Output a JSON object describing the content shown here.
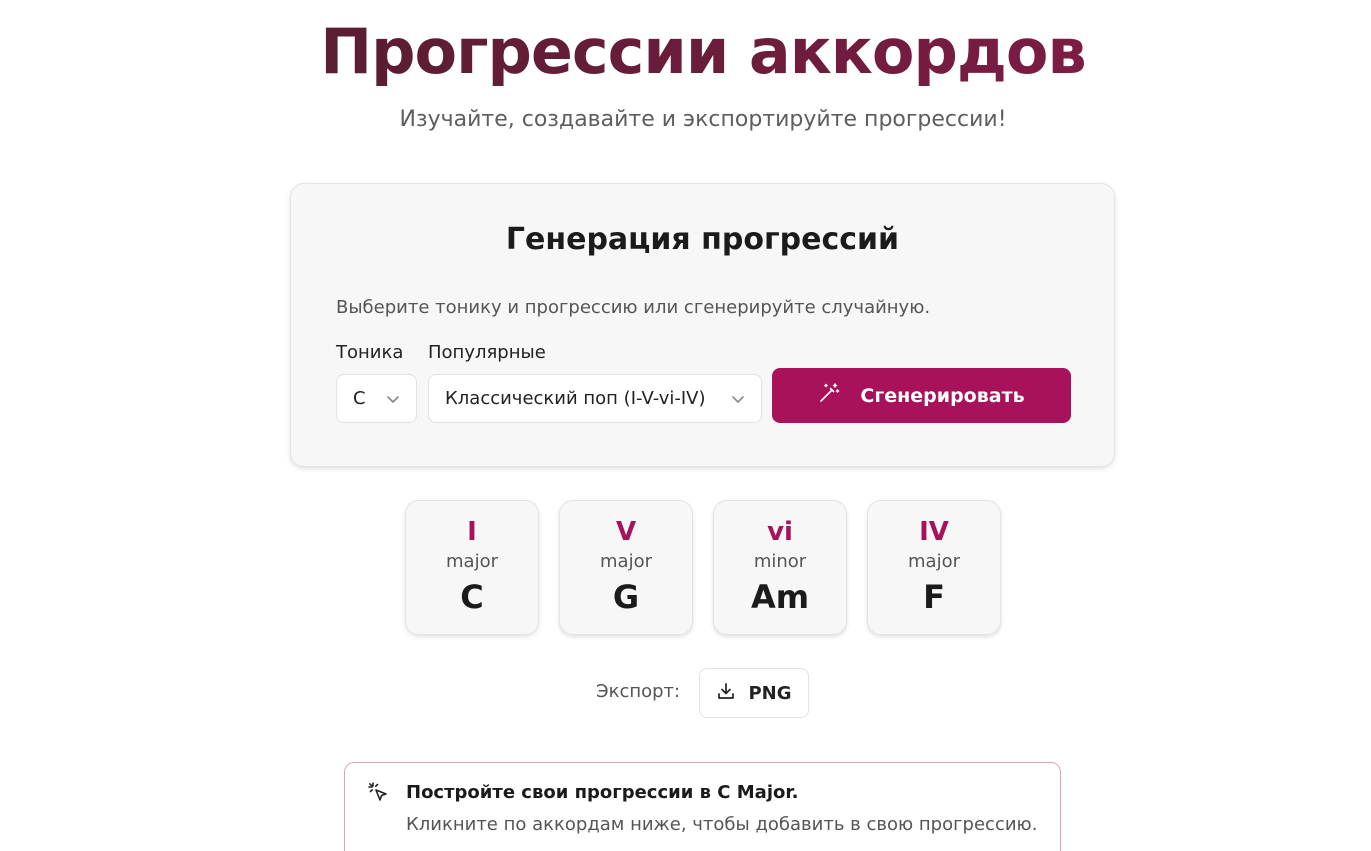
{
  "header": {
    "title": "Прогрессии аккордов",
    "subtitle": "Изучайте, создавайте и экспортируйте прогрессии!"
  },
  "generator": {
    "title": "Генерация прогрессий",
    "description": "Выберите тонику и прогрессию или сгенерируйте случайную.",
    "tonic_label": "Тоника",
    "tonic_value": "C",
    "popular_label": "Популярные",
    "popular_value": "Классический поп (I-V-vi-IV)",
    "generate_label": "Сгенерировать"
  },
  "chords": [
    {
      "roman": "I",
      "quality": "major",
      "name": "C"
    },
    {
      "roman": "V",
      "quality": "major",
      "name": "G"
    },
    {
      "roman": "vi",
      "quality": "minor",
      "name": "Am"
    },
    {
      "roman": "IV",
      "quality": "major",
      "name": "F"
    }
  ],
  "export": {
    "label": "Экспорт:",
    "png_label": "PNG"
  },
  "tip": {
    "title": "Постройте свои прогрессии в C Major.",
    "text": "Кликните по аккордам ниже, чтобы добавить в свою прогрессию."
  },
  "colors": {
    "accent": "#a8125a",
    "title_gradient_start": "#4b1d2c",
    "title_gradient_end": "#8c1a4a"
  }
}
